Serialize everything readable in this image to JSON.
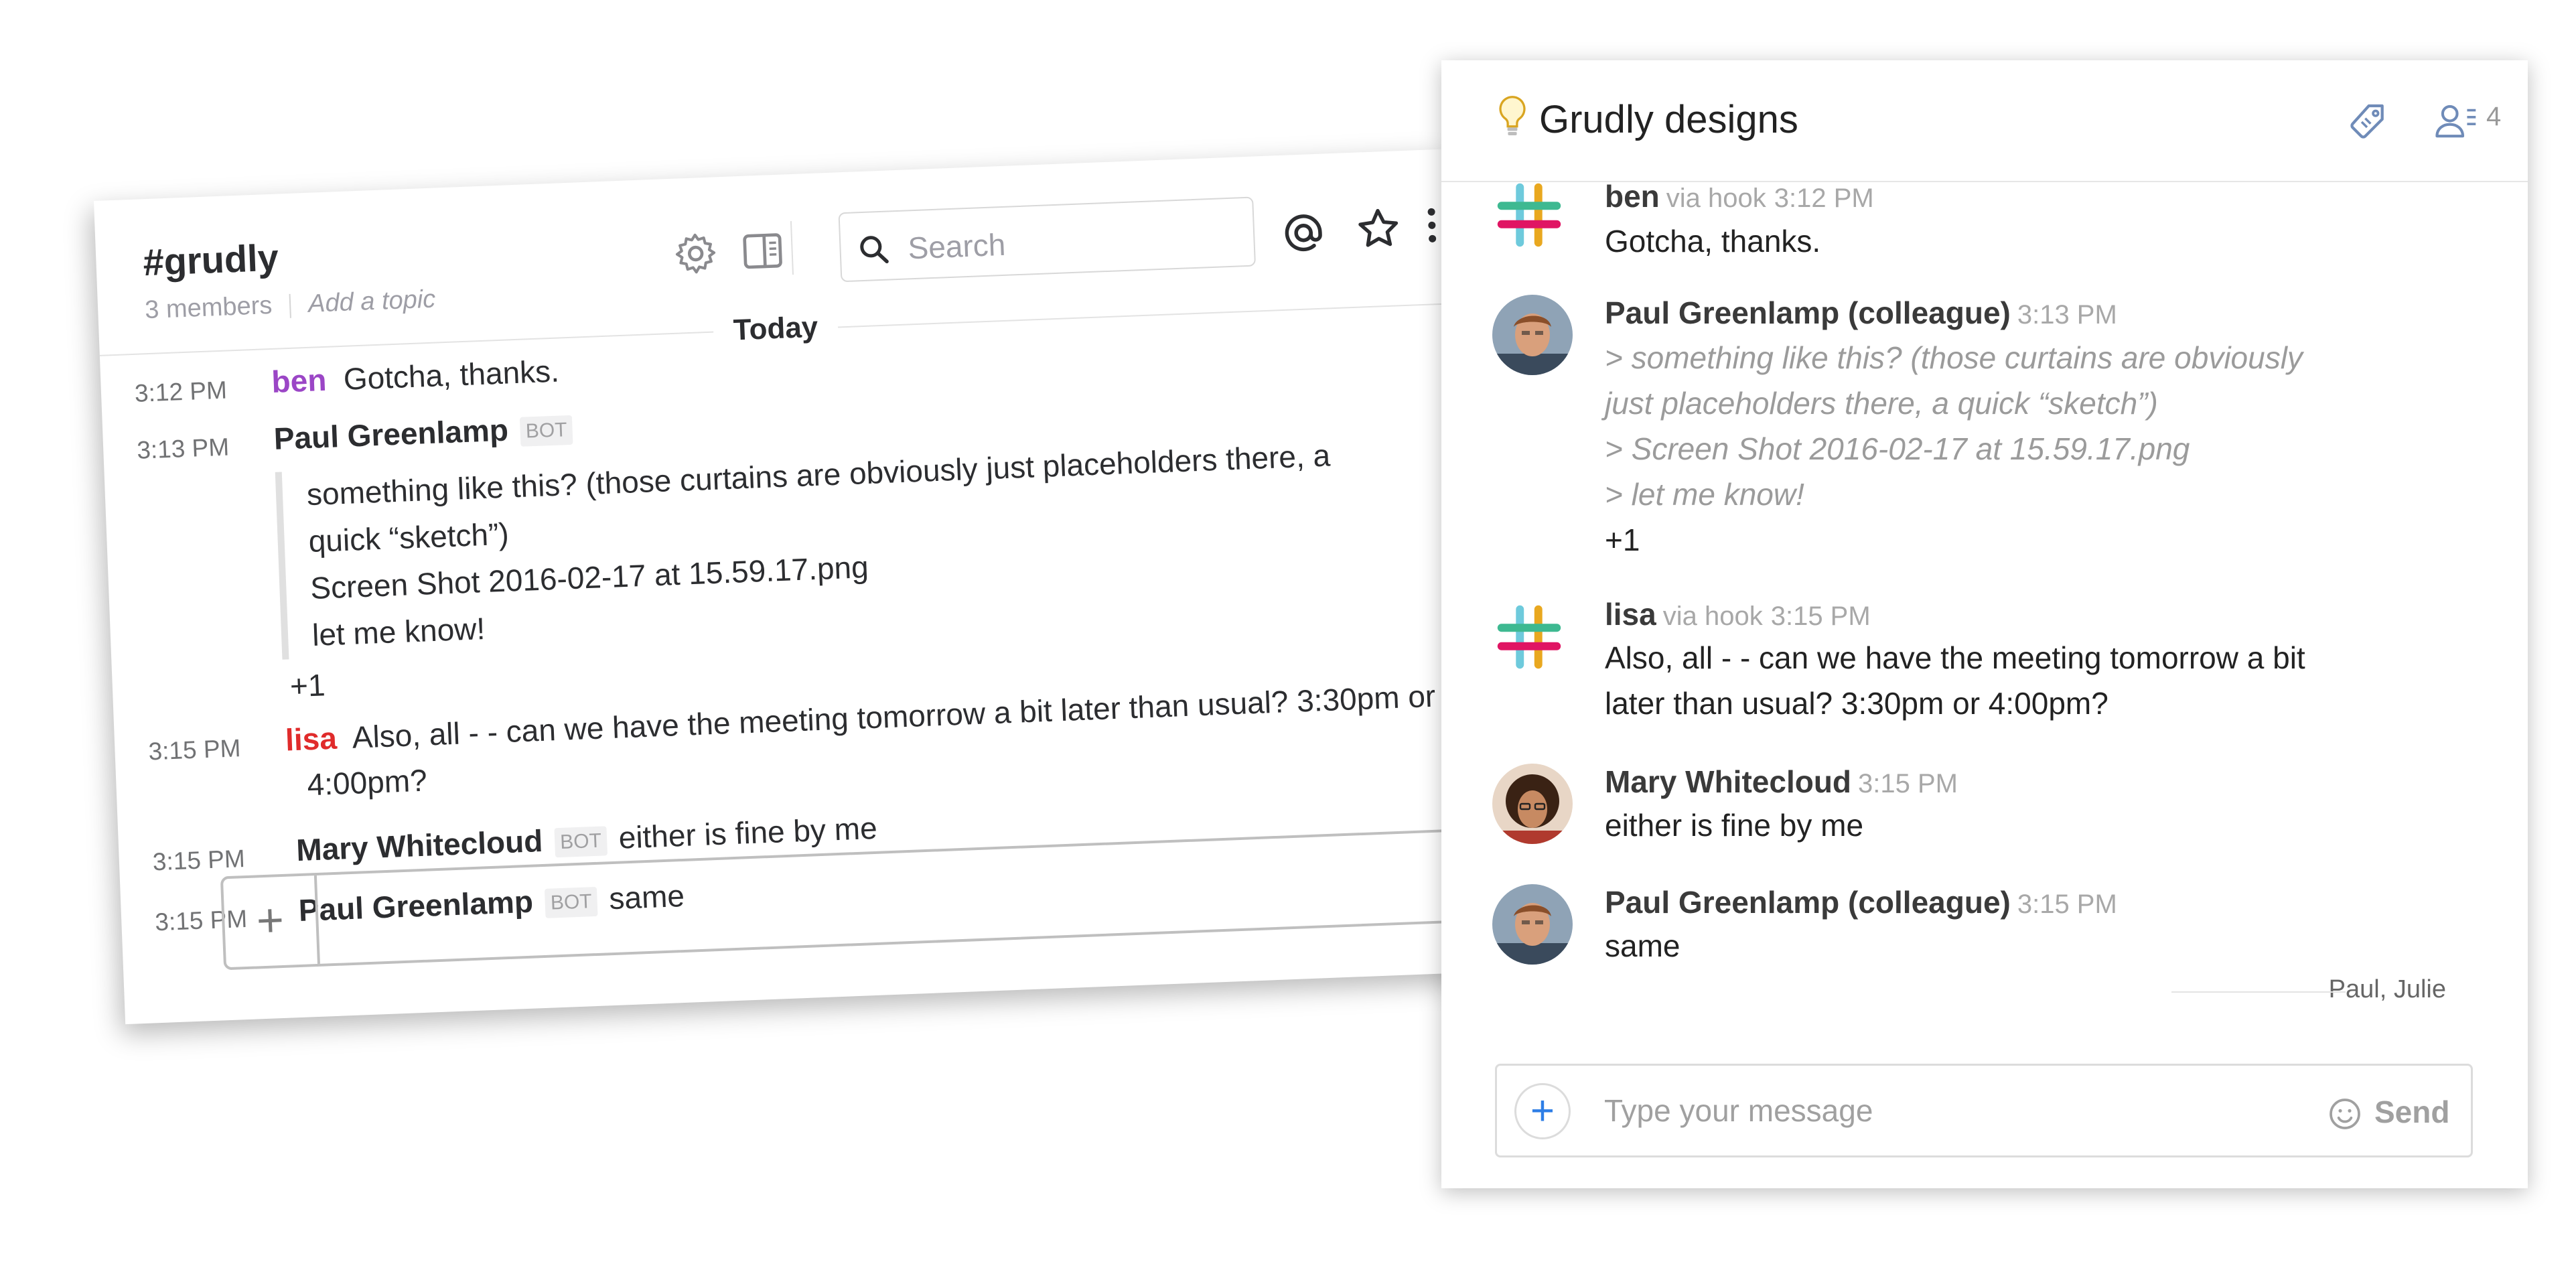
{
  "slack": {
    "channel": "#grudly",
    "members": "3 members",
    "add_topic": "Add a topic",
    "search_placeholder": "Search",
    "divider": "Today",
    "messages": [
      {
        "time": "3:12 PM",
        "author": "ben",
        "author_color": "#9b46c6",
        "text": "Gotcha, thanks."
      },
      {
        "time": "3:13 PM",
        "author": "Paul Greenlamp",
        "badge": "BOT",
        "quote": [
          "something like this? (those curtains are obviously just placeholders there, a",
          "quick “sketch”)",
          "Screen Shot 2016-02-17 at 15.59.17.png",
          "let me know!"
        ],
        "text": "+1"
      },
      {
        "time": "3:15 PM",
        "author": "lisa",
        "author_color": "#e02b2b",
        "text_line1": "Also, all - - can we have the meeting tomorrow a bit later than usual? 3:30pm or",
        "text_line2": "4:00pm?"
      },
      {
        "time": "3:15 PM",
        "author": "Mary Whitecloud",
        "badge": "BOT",
        "text": "either is fine by me"
      },
      {
        "time": "3:15 PM",
        "author": "Paul Greenlamp",
        "badge": "BOT",
        "text": "same"
      }
    ]
  },
  "widget": {
    "title": "Grudly designs",
    "member_count": "4",
    "messages": [
      {
        "author": "ben",
        "via": "via hook",
        "time": "3:12 PM",
        "avatar": "slack-logo",
        "lines": [
          "Gotcha, thanks."
        ]
      },
      {
        "author": "Paul Greenlamp (colleague)",
        "time": "3:13 PM",
        "avatar": "person-photo",
        "quote": [
          "> something like this? (those curtains are obviously",
          "just placeholders there, a quick “sketch”)",
          "> Screen Shot 2016-02-17 at 15.59.17.png",
          "> let me know!"
        ],
        "lines": [
          "+1"
        ]
      },
      {
        "author": "lisa",
        "via": "via hook",
        "time": "3:15 PM",
        "avatar": "slack-logo",
        "lines": [
          "Also, all - - can we have the meeting tomorrow a bit",
          "later than usual? 3:30pm or 4:00pm?"
        ]
      },
      {
        "author": "Mary Whitecloud",
        "time": "3:15 PM",
        "avatar": "person-photo",
        "lines": [
          "either is fine by me"
        ]
      },
      {
        "author": "Paul Greenlamp (colleague)",
        "time": "3:15 PM",
        "avatar": "person-photo",
        "lines": [
          "same"
        ]
      }
    ],
    "seen_by": "Paul, Julie",
    "input_placeholder": "Type your message",
    "send_label": "Send"
  }
}
